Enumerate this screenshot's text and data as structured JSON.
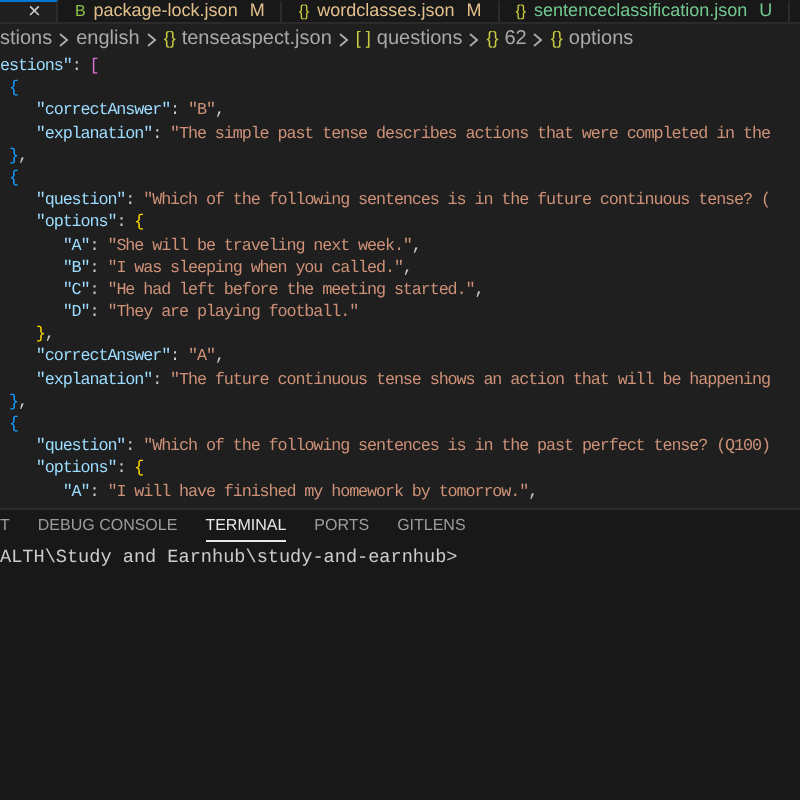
{
  "tabs": [
    {
      "close": "×",
      "selected": true
    },
    {
      "icon": "B",
      "label": "package-lock.json",
      "color": "#e2c08d",
      "badge": "M",
      "selected": false
    },
    {
      "icon": "{}",
      "label": "wordclasses.json",
      "color": "#e2c08d",
      "badge": "M",
      "selected": false
    },
    {
      "icon": "{}",
      "label": "sentenceclassification.json",
      "color": "#73c991",
      "badge": "U",
      "selected": false
    }
  ],
  "breadcrumbs": [
    {
      "label": "stions"
    },
    {
      "label": "english"
    },
    {
      "icon": "{}",
      "label": "tenseaspect.json"
    },
    {
      "icon": "[ ]",
      "label": "questions"
    },
    {
      "icon": "{}",
      "label": "62"
    },
    {
      "icon": "{}",
      "label": "options"
    }
  ],
  "code_lines": [
    [
      {
        "kind": "key",
        "text": "estions\""
      },
      {
        "kind": "punct",
        "text": ": "
      },
      {
        "kind": "bracket",
        "color": "#da70d6",
        "text": "["
      }
    ],
    [
      {
        "kind": "bracket",
        "color": "#179fff",
        "text": " {"
      }
    ],
    [
      {
        "kind": "key",
        "text": "    \"correctAnswer\""
      },
      {
        "kind": "punct",
        "text": ": "
      },
      {
        "kind": "string",
        "text": "\"B\""
      },
      {
        "kind": "punct",
        "text": ","
      }
    ],
    [
      {
        "kind": "key",
        "text": "    \"explanation\""
      },
      {
        "kind": "punct",
        "text": ": "
      },
      {
        "kind": "string",
        "text": "\"The simple past tense describes actions that were completed in the"
      }
    ],
    [
      {
        "kind": "bracket",
        "color": "#179fff",
        "text": " }"
      },
      {
        "kind": "punct",
        "text": ","
      }
    ],
    [
      {
        "kind": "bracket",
        "color": "#179fff",
        "text": " {"
      }
    ],
    [
      {
        "kind": "key",
        "text": "    \"question\""
      },
      {
        "kind": "punct",
        "text": ": "
      },
      {
        "kind": "string",
        "text": "\"Which of the following sentences is in the future continuous tense? ("
      }
    ],
    [
      {
        "kind": "key",
        "text": "    \"options\""
      },
      {
        "kind": "punct",
        "text": ": "
      },
      {
        "kind": "bracket",
        "color": "#ffd700",
        "text": "{"
      }
    ],
    [
      {
        "kind": "key",
        "text": "       \"A\""
      },
      {
        "kind": "punct",
        "text": ": "
      },
      {
        "kind": "string",
        "text": "\"She will be traveling next week.\""
      },
      {
        "kind": "punct",
        "text": ","
      }
    ],
    [
      {
        "kind": "key",
        "text": "       \"B\""
      },
      {
        "kind": "punct",
        "text": ": "
      },
      {
        "kind": "string",
        "text": "\"I was sleeping when you called.\""
      },
      {
        "kind": "punct",
        "text": ","
      }
    ],
    [
      {
        "kind": "key",
        "text": "       \"C\""
      },
      {
        "kind": "punct",
        "text": ": "
      },
      {
        "kind": "string",
        "text": "\"He had left before the meeting started.\""
      },
      {
        "kind": "punct",
        "text": ","
      }
    ],
    [
      {
        "kind": "key",
        "text": "       \"D\""
      },
      {
        "kind": "punct",
        "text": ": "
      },
      {
        "kind": "string",
        "text": "\"They are playing football.\""
      }
    ],
    [
      {
        "kind": "bracket",
        "color": "#ffd700",
        "text": "    }"
      },
      {
        "kind": "punct",
        "text": ","
      }
    ],
    [
      {
        "kind": "key",
        "text": "    \"correctAnswer\""
      },
      {
        "kind": "punct",
        "text": ": "
      },
      {
        "kind": "string",
        "text": "\"A\""
      },
      {
        "kind": "punct",
        "text": ","
      }
    ],
    [
      {
        "kind": "key",
        "text": "    \"explanation\""
      },
      {
        "kind": "punct",
        "text": ": "
      },
      {
        "kind": "string",
        "text": "\"The future continuous tense shows an action that will be happening"
      }
    ],
    [
      {
        "kind": "bracket",
        "color": "#179fff",
        "text": " }"
      },
      {
        "kind": "punct",
        "text": ","
      }
    ],
    [
      {
        "kind": "bracket",
        "color": "#179fff",
        "text": " {"
      }
    ],
    [
      {
        "kind": "key",
        "text": "    \"question\""
      },
      {
        "kind": "punct",
        "text": ": "
      },
      {
        "kind": "string",
        "text": "\"Which of the following sentences is in the past perfect tense? (Q100)"
      }
    ],
    [
      {
        "kind": "key",
        "text": "    \"options\""
      },
      {
        "kind": "punct",
        "text": ": "
      },
      {
        "kind": "bracket",
        "color": "#ffd700",
        "text": "{"
      }
    ],
    [
      {
        "kind": "key",
        "text": "       \"A\""
      },
      {
        "kind": "punct",
        "text": ": "
      },
      {
        "kind": "string",
        "text": "\"I will have finished my homework by tomorrow.\""
      },
      {
        "kind": "punct",
        "text": ","
      }
    ]
  ],
  "panel_tabs": [
    {
      "label": "T",
      "selected": false
    },
    {
      "label": "DEBUG CONSOLE",
      "selected": false
    },
    {
      "label": "TERMINAL",
      "selected": true
    },
    {
      "label": "PORTS",
      "selected": false
    },
    {
      "label": "GITLENS",
      "selected": false
    }
  ],
  "terminal_lines": [
    "ALTH\\Study and Earnhub\\study-and-earnhub>"
  ]
}
